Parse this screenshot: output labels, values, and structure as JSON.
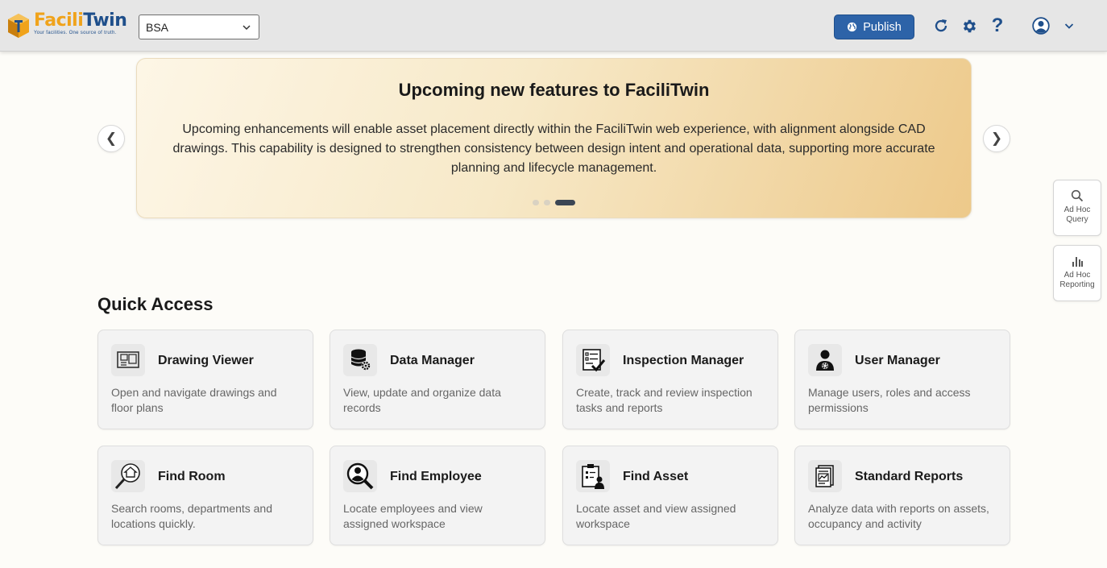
{
  "header": {
    "logo": {
      "name_part1": "Facili",
      "name_part2": "Twin",
      "tagline": "Your facilities. One source of truth."
    },
    "org_select": {
      "value": "BSA"
    },
    "publish_label": "Publish",
    "help_glyph": "?",
    "icons": [
      "globe-icon",
      "refresh-icon",
      "gear-icon",
      "help-icon",
      "user-avatar-icon",
      "chevron-down-icon"
    ]
  },
  "carousel": {
    "title": "Upcoming new features to FaciliTwin",
    "body": "Upcoming enhancements will enable asset placement directly within the FaciliTwin web experience, with alignment alongside CAD drawings. This capability is designed to strengthen consistency between design intent and operational data, supporting more accurate planning and lifecycle management.",
    "prev_glyph": "❮",
    "next_glyph": "❯",
    "slide_count": 3,
    "active_slide": 3
  },
  "side_tools": [
    {
      "label": "Ad Hoc Query",
      "icon": "search-icon"
    },
    {
      "label": "Ad Hoc Reporting",
      "icon": "bar-chart-icon"
    }
  ],
  "quick_access": {
    "title": "Quick Access",
    "cards": [
      {
        "title": "Drawing Viewer",
        "desc": "Open and navigate drawings and floor plans",
        "icon": "floor-plan-icon"
      },
      {
        "title": "Data Manager",
        "desc": "View, update and organize data records",
        "icon": "database-gear-icon"
      },
      {
        "title": "Inspection Manager",
        "desc": "Create, track and review inspection tasks and reports",
        "icon": "checklist-icon"
      },
      {
        "title": "User Manager",
        "desc": "Manage users, roles and access permissions",
        "icon": "user-gear-icon"
      },
      {
        "title": "Find Room",
        "desc": "Search rooms, departments and locations quickly.",
        "icon": "search-home-icon"
      },
      {
        "title": "Find Employee",
        "desc": "Locate employees and view assigned workspace",
        "icon": "search-person-icon"
      },
      {
        "title": "Find Asset",
        "desc": "Locate asset and view assigned workspace",
        "icon": "asset-clipboard-icon"
      },
      {
        "title": "Standard Reports",
        "desc": "Analyze data with reports on assets, occupancy and activity",
        "icon": "report-chart-icon"
      }
    ]
  },
  "colors": {
    "brand_blue": "#1f4f8b",
    "brand_orange": "#f0a31b",
    "publish_bg": "#2d63a8",
    "page_bg": "#fdfcf8"
  }
}
